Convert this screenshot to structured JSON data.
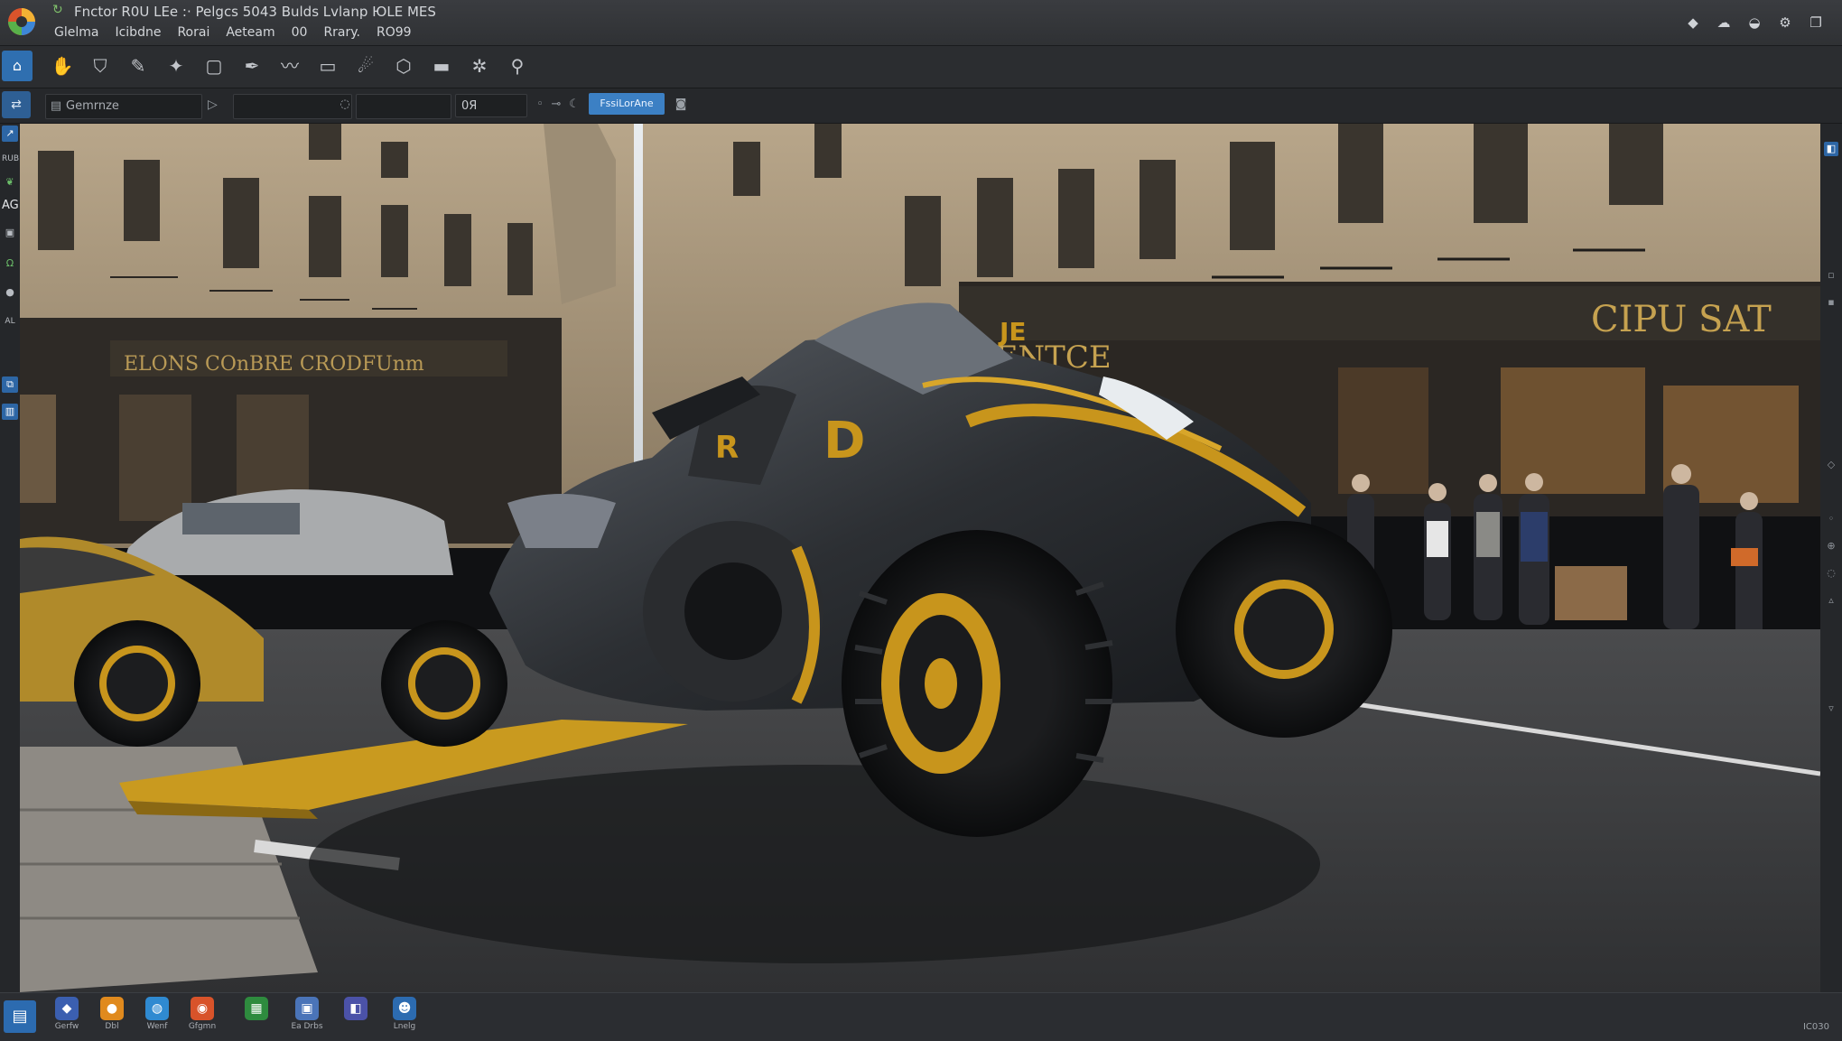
{
  "titlebar": {
    "title": "Fnctor R0U LEe :·  Pelgcs 5043   Bulds Lvlanp ЮLE MES",
    "menu": [
      "Glelma",
      "Icibdne",
      "Rorai",
      "Aeteam",
      "00",
      "Rrary.",
      "RO99"
    ]
  },
  "optionsbar": {
    "field1_value": "Gemrnze",
    "field4_value": "0Я",
    "button_label": "FssiLorAne"
  },
  "leftstrip": {
    "labels": [
      "RUB",
      "AG",
      "AL"
    ]
  },
  "taskbar": {
    "items": [
      {
        "label": "Gerfw",
        "icon": "app-icon",
        "color": "#3b5fb0"
      },
      {
        "label": "Dbl",
        "icon": "firefox-icon",
        "color": "#e08a1e"
      },
      {
        "label": "Wenf",
        "icon": "globe-icon",
        "color": "#2f8ad1"
      },
      {
        "label": "Gfgmn",
        "icon": "chrome-icon",
        "color": "#d8532a"
      },
      {
        "label": "",
        "icon": "spreadsheet-icon",
        "color": "#2e8b3e"
      },
      {
        "label": "Ea Drbs",
        "icon": "folder-icon",
        "color": "#4a74b8"
      },
      {
        "label": "",
        "icon": "dev-icon",
        "color": "#4b52a8"
      },
      {
        "label": "Lnelg",
        "icon": "user-icon",
        "color": "#2c6bb0"
      }
    ],
    "clock": "IC030"
  },
  "canvas": {
    "storefront_left": "ELONS COnBRE CRODFUnm",
    "storefront_right_1": "RENTCE",
    "storefront_right_2": "CIPU SAT",
    "vehicle_decal_1": "R",
    "vehicle_decal_2": "D",
    "vehicle_decal_3": "JE"
  }
}
